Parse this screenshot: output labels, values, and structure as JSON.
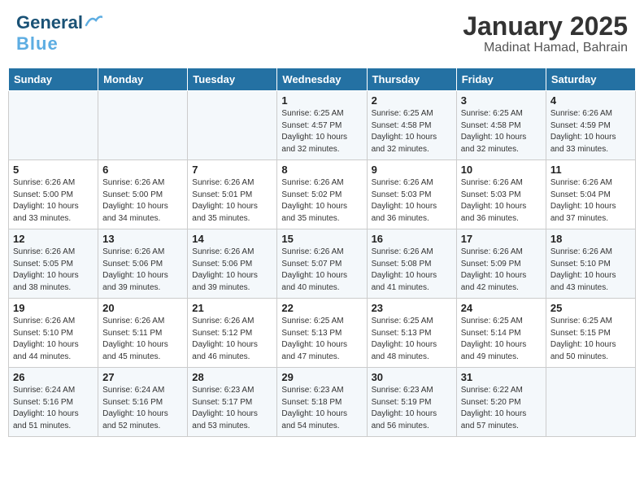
{
  "header": {
    "logo_general": "General",
    "logo_blue": "Blue",
    "month": "January 2025",
    "location": "Madinat Hamad, Bahrain"
  },
  "days_of_week": [
    "Sunday",
    "Monday",
    "Tuesday",
    "Wednesday",
    "Thursday",
    "Friday",
    "Saturday"
  ],
  "weeks": [
    [
      {
        "day": "",
        "info": ""
      },
      {
        "day": "",
        "info": ""
      },
      {
        "day": "",
        "info": ""
      },
      {
        "day": "1",
        "info": "Sunrise: 6:25 AM\nSunset: 4:57 PM\nDaylight: 10 hours\nand 32 minutes."
      },
      {
        "day": "2",
        "info": "Sunrise: 6:25 AM\nSunset: 4:58 PM\nDaylight: 10 hours\nand 32 minutes."
      },
      {
        "day": "3",
        "info": "Sunrise: 6:25 AM\nSunset: 4:58 PM\nDaylight: 10 hours\nand 32 minutes."
      },
      {
        "day": "4",
        "info": "Sunrise: 6:26 AM\nSunset: 4:59 PM\nDaylight: 10 hours\nand 33 minutes."
      }
    ],
    [
      {
        "day": "5",
        "info": "Sunrise: 6:26 AM\nSunset: 5:00 PM\nDaylight: 10 hours\nand 33 minutes."
      },
      {
        "day": "6",
        "info": "Sunrise: 6:26 AM\nSunset: 5:00 PM\nDaylight: 10 hours\nand 34 minutes."
      },
      {
        "day": "7",
        "info": "Sunrise: 6:26 AM\nSunset: 5:01 PM\nDaylight: 10 hours\nand 35 minutes."
      },
      {
        "day": "8",
        "info": "Sunrise: 6:26 AM\nSunset: 5:02 PM\nDaylight: 10 hours\nand 35 minutes."
      },
      {
        "day": "9",
        "info": "Sunrise: 6:26 AM\nSunset: 5:03 PM\nDaylight: 10 hours\nand 36 minutes."
      },
      {
        "day": "10",
        "info": "Sunrise: 6:26 AM\nSunset: 5:03 PM\nDaylight: 10 hours\nand 36 minutes."
      },
      {
        "day": "11",
        "info": "Sunrise: 6:26 AM\nSunset: 5:04 PM\nDaylight: 10 hours\nand 37 minutes."
      }
    ],
    [
      {
        "day": "12",
        "info": "Sunrise: 6:26 AM\nSunset: 5:05 PM\nDaylight: 10 hours\nand 38 minutes."
      },
      {
        "day": "13",
        "info": "Sunrise: 6:26 AM\nSunset: 5:06 PM\nDaylight: 10 hours\nand 39 minutes."
      },
      {
        "day": "14",
        "info": "Sunrise: 6:26 AM\nSunset: 5:06 PM\nDaylight: 10 hours\nand 39 minutes."
      },
      {
        "day": "15",
        "info": "Sunrise: 6:26 AM\nSunset: 5:07 PM\nDaylight: 10 hours\nand 40 minutes."
      },
      {
        "day": "16",
        "info": "Sunrise: 6:26 AM\nSunset: 5:08 PM\nDaylight: 10 hours\nand 41 minutes."
      },
      {
        "day": "17",
        "info": "Sunrise: 6:26 AM\nSunset: 5:09 PM\nDaylight: 10 hours\nand 42 minutes."
      },
      {
        "day": "18",
        "info": "Sunrise: 6:26 AM\nSunset: 5:10 PM\nDaylight: 10 hours\nand 43 minutes."
      }
    ],
    [
      {
        "day": "19",
        "info": "Sunrise: 6:26 AM\nSunset: 5:10 PM\nDaylight: 10 hours\nand 44 minutes."
      },
      {
        "day": "20",
        "info": "Sunrise: 6:26 AM\nSunset: 5:11 PM\nDaylight: 10 hours\nand 45 minutes."
      },
      {
        "day": "21",
        "info": "Sunrise: 6:26 AM\nSunset: 5:12 PM\nDaylight: 10 hours\nand 46 minutes."
      },
      {
        "day": "22",
        "info": "Sunrise: 6:25 AM\nSunset: 5:13 PM\nDaylight: 10 hours\nand 47 minutes."
      },
      {
        "day": "23",
        "info": "Sunrise: 6:25 AM\nSunset: 5:13 PM\nDaylight: 10 hours\nand 48 minutes."
      },
      {
        "day": "24",
        "info": "Sunrise: 6:25 AM\nSunset: 5:14 PM\nDaylight: 10 hours\nand 49 minutes."
      },
      {
        "day": "25",
        "info": "Sunrise: 6:25 AM\nSunset: 5:15 PM\nDaylight: 10 hours\nand 50 minutes."
      }
    ],
    [
      {
        "day": "26",
        "info": "Sunrise: 6:24 AM\nSunset: 5:16 PM\nDaylight: 10 hours\nand 51 minutes."
      },
      {
        "day": "27",
        "info": "Sunrise: 6:24 AM\nSunset: 5:16 PM\nDaylight: 10 hours\nand 52 minutes."
      },
      {
        "day": "28",
        "info": "Sunrise: 6:23 AM\nSunset: 5:17 PM\nDaylight: 10 hours\nand 53 minutes."
      },
      {
        "day": "29",
        "info": "Sunrise: 6:23 AM\nSunset: 5:18 PM\nDaylight: 10 hours\nand 54 minutes."
      },
      {
        "day": "30",
        "info": "Sunrise: 6:23 AM\nSunset: 5:19 PM\nDaylight: 10 hours\nand 56 minutes."
      },
      {
        "day": "31",
        "info": "Sunrise: 6:22 AM\nSunset: 5:20 PM\nDaylight: 10 hours\nand 57 minutes."
      },
      {
        "day": "",
        "info": ""
      }
    ]
  ]
}
